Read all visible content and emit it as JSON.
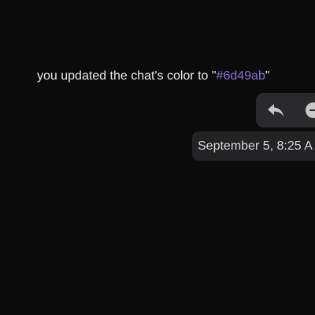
{
  "system_message": {
    "prefix": "you updated the chat's color to \"",
    "color_value": "#6d49ab",
    "suffix": "\""
  },
  "message_actions": {
    "reply_icon": "reply-icon",
    "more_icon": "more-options-icon"
  },
  "timestamp": {
    "text": "September 5, 8:25 A"
  },
  "colors": {
    "background": "#0b0b0b",
    "accent": "#6d49ab",
    "action_bar": "#2a2a2c",
    "tooltip": "#232325"
  }
}
